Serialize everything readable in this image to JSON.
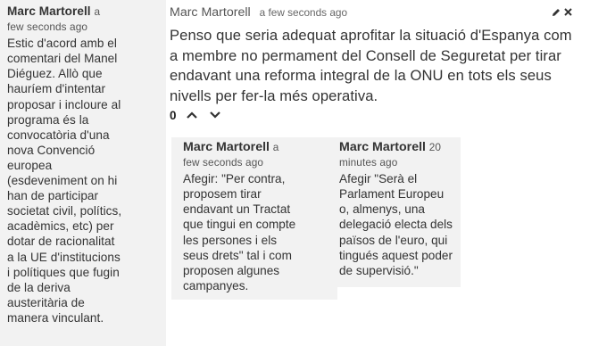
{
  "left_comment": {
    "author": "Marc Martorell",
    "time_lead": "a",
    "time_rest": "few seconds ago",
    "lines": [
      "Estic d'acord amb el",
      "comentari del Manel",
      "Diéguez. Allò que",
      "hauríem d'intentar",
      "proposar i incloure al",
      "programa és la",
      "convocatòria d'una",
      "nova Convenció",
      "europea",
      "(esdeveniment on hi",
      "han de participar",
      "societat civil, polítics,",
      "acadèmics, etc) per",
      "dotar de racionalitat",
      "a la UE d'institucions",
      "i polítiques que fugin",
      "de la deriva",
      "austeritària de",
      "manera vinculant."
    ]
  },
  "main_post": {
    "author": "Marc Martorell",
    "time": "a few seconds ago",
    "edit_icon": "pencil-icon",
    "delete_icon": "close-icon",
    "lines": [
      "Penso que seria adequat aprofitar la situació d'Espanya com",
      "a membre no permament del Consell de Seguretat per tirar",
      "endavant una reforma integral de la ONU en tots els seus",
      "nivells per fer-la més operativa."
    ],
    "vote_count": "0"
  },
  "replies": [
    {
      "author": "Marc Martorell",
      "time_lead": "a",
      "time_rest": "few seconds ago",
      "lines": [
        "Afegir: \"Per contra,",
        "proposem tirar",
        "endavant un Tractat",
        "que tingui en compte",
        "les persones i els",
        "seus drets\" tal i com",
        "proposen algunes",
        "campanyes."
      ]
    },
    {
      "author": "Marc Martorell",
      "time_lead": "20",
      "time_rest": "minutes ago",
      "lines": [
        "Afegir \"Serà el",
        "Parlament Europeu",
        "o, almenys, una",
        "delegació electa dels",
        "països de l'euro, qui",
        "tingués aquest poder",
        "de supervisió.\""
      ]
    }
  ]
}
